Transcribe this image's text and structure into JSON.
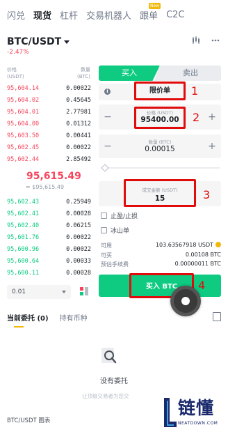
{
  "top_tabs": [
    {
      "label": "闪兑",
      "active": false
    },
    {
      "label": "现货",
      "active": true
    },
    {
      "label": "杠杆",
      "active": false
    },
    {
      "label": "交易机器人",
      "active": false
    },
    {
      "label": "跟单",
      "active": false,
      "badge": "New"
    },
    {
      "label": "C2C",
      "active": false
    }
  ],
  "pair": {
    "name": "BTC/USDT",
    "change": "-2.47%"
  },
  "orderbook": {
    "price_header": "价格\n(USDT)",
    "qty_header": "数量\n(BTC)",
    "asks": [
      {
        "price": "95,604.14",
        "qty": "0.00022"
      },
      {
        "price": "95,604.02",
        "qty": "0.45645"
      },
      {
        "price": "95,604.01",
        "qty": "2.77981"
      },
      {
        "price": "95,604.00",
        "qty": "0.01312"
      },
      {
        "price": "95,603.50",
        "qty": "0.00441"
      },
      {
        "price": "95,602.45",
        "qty": "0.00022"
      },
      {
        "price": "95,602.44",
        "qty": "2.85492"
      }
    ],
    "mid_price": "95,615.49",
    "mid_sub": "≈ $95,615.49",
    "bids": [
      {
        "price": "95,602.43",
        "qty": "0.25949"
      },
      {
        "price": "95,602.41",
        "qty": "0.00028"
      },
      {
        "price": "95,602.40",
        "qty": "0.06215"
      },
      {
        "price": "95,601.76",
        "qty": "0.00022"
      },
      {
        "price": "95,600.96",
        "qty": "0.00022"
      },
      {
        "price": "95,600.64",
        "qty": "0.00033"
      },
      {
        "price": "95,600.11",
        "qty": "0.00028"
      }
    ],
    "depth": "0.01"
  },
  "trade": {
    "buy_tab": "买入",
    "sell_tab": "卖出",
    "order_type": "限价单",
    "price_label": "价格 (USDT)",
    "price_value": "95400.00",
    "qty_label": "数量 (BTC)",
    "qty_value": "0.00015",
    "total_label": "成交金额 (USDT)",
    "total_value": "15",
    "tp_sl": "止盈/止损",
    "iceberg": "冰山单",
    "available_label": "可用",
    "available_value": "103.63567918 USDT",
    "can_buy_label": "可买",
    "can_buy_value": "0.00108 BTC",
    "fee_label": "预估手续费",
    "fee_value": "0.00000011 BTC",
    "buy_button": "买入 BTC"
  },
  "annotations": [
    "1",
    "2",
    "3",
    "4"
  ],
  "bottom": {
    "tabs": [
      {
        "label": "当前委托 (0)",
        "active": true
      },
      {
        "label": "持有币种",
        "active": false
      }
    ],
    "empty_title": "没有委托",
    "empty_sub": "让顶级交易者为您交",
    "chart_title": "BTC/USDT 图表"
  },
  "watermark": {
    "text": "链懂",
    "sub": "NEATDOWN.COM"
  },
  "colors": {
    "green": "#0ecb81",
    "red": "#f6465d",
    "annotation": "#e00b0b"
  }
}
